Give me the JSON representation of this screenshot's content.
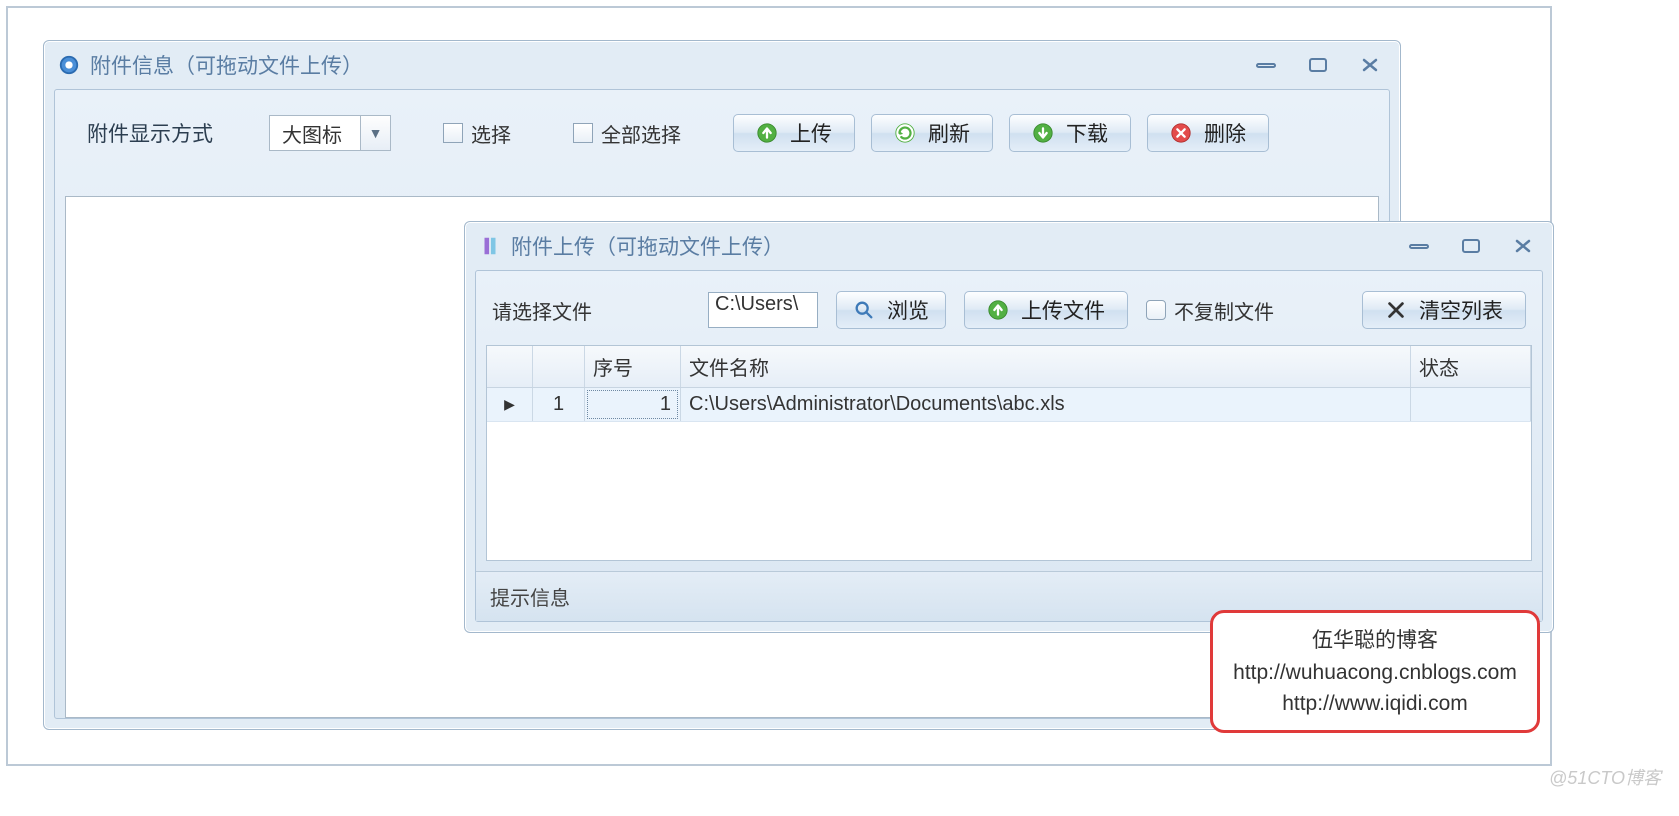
{
  "window1": {
    "title": "附件信息（可拖动文件上传）",
    "display_mode_label": "附件显示方式",
    "display_mode_value": "大图标",
    "checkbox_select": "选择",
    "checkbox_select_all": "全部选择",
    "btn_upload": "上传",
    "btn_refresh": "刷新",
    "btn_download": "下载",
    "btn_delete": "删除"
  },
  "window2": {
    "title": "附件上传（可拖动文件上传）",
    "select_file_label": "请选择文件",
    "path_value": "C:\\Users\\",
    "btn_browse": "浏览",
    "btn_upload_file": "上传文件",
    "checkbox_no_copy": "不复制文件",
    "btn_clear_list": "清空列表",
    "table": {
      "headers": {
        "seq": "序号",
        "fname": "文件名称",
        "status": "状态"
      },
      "rows": [
        {
          "idx": "1",
          "seq": "1",
          "fname": "C:\\Users\\Administrator\\Documents\\abc.xls",
          "status": ""
        }
      ]
    },
    "footer": "提示信息"
  },
  "callout": {
    "line1": "伍华聪的博客",
    "line2": "http://wuhuacong.cnblogs.com",
    "line3": "http://www.iqidi.com"
  },
  "watermark": "@51CTO博客"
}
